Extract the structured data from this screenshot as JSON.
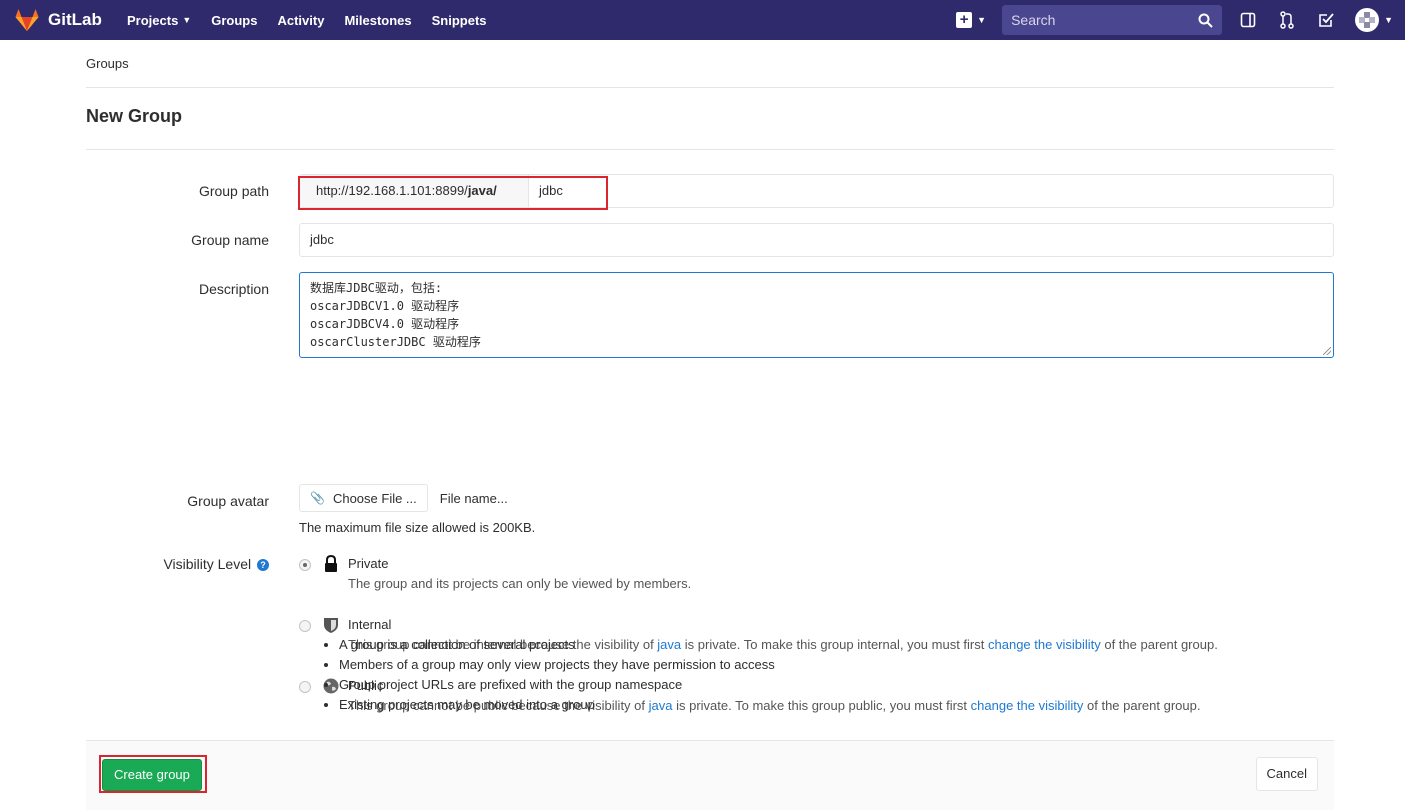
{
  "navbar": {
    "brand": "GitLab",
    "links": [
      {
        "label": "Projects",
        "dropdown": true
      },
      {
        "label": "Groups"
      },
      {
        "label": "Activity"
      },
      {
        "label": "Milestones"
      },
      {
        "label": "Snippets"
      }
    ],
    "search_placeholder": "Search",
    "icons": [
      "plus-square-icon",
      "search-icon",
      "sidebar-icon",
      "merge-request-icon",
      "todo-check-icon",
      "user-avatar-icon"
    ]
  },
  "breadcrumb": "Groups",
  "page_title": "New Group",
  "form": {
    "group_path": {
      "label": "Group path",
      "prefix": "http://192.168.1.101:8899/",
      "parent": "java/",
      "value": "jdbc"
    },
    "group_name": {
      "label": "Group name",
      "value": "jdbc"
    },
    "description": {
      "label": "Description",
      "lines": [
        "数据库JDBC驱动，包括:",
        "oscarJDBCV1.0 驱动程序",
        "oscarJDBCV4.0 驱动程序",
        "oscarClusterJDBC 驱动程序"
      ]
    },
    "avatar": {
      "label": "Group avatar",
      "choose_button": "Choose File ...",
      "file_name": "File name...",
      "help": "The maximum file size allowed is 200KB."
    },
    "visibility": {
      "label": "Visibility Level",
      "options": [
        {
          "title": "Private",
          "checked": true,
          "desc_before": "The group and its projects can only be viewed by members.",
          "link1": "",
          "desc_mid": "",
          "link2": "",
          "desc_after": ""
        },
        {
          "title": "Internal",
          "checked": false,
          "desc_before": "This group cannot be internal because the visibility of ",
          "link1": "java",
          "desc_mid": " is private. To make this group internal, you must first ",
          "link2": "change the visibility",
          "desc_after": " of the parent group."
        },
        {
          "title": "Public",
          "checked": false,
          "desc_before": "This group cannot be public because the visibility of ",
          "link1": "java",
          "desc_mid": " is private. To make this group public, you must first ",
          "link2": "change the visibility",
          "desc_after": " of the parent group."
        }
      ]
    },
    "notes": [
      "A group is a collection of several projects",
      "Members of a group may only view projects they have permission to access",
      "Group project URLs are prefixed with the group namespace",
      "Existing projects may be moved into a group"
    ],
    "create_button": "Create group",
    "cancel_button": "Cancel"
  },
  "colors": {
    "navbar": "#2f2a6b",
    "primary_link": "#1f78d1",
    "success": "#1aaa55",
    "highlight_box": "#d9252e"
  }
}
